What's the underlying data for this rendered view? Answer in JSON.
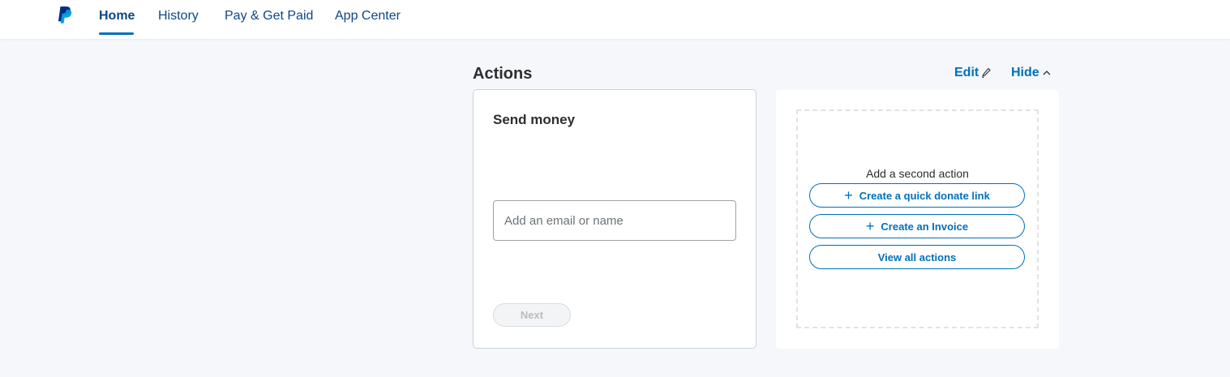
{
  "nav": {
    "items": [
      {
        "label": "Home",
        "active": true
      },
      {
        "label": "History"
      },
      {
        "label": "Pay & Get Paid"
      },
      {
        "label": "App Center"
      }
    ]
  },
  "actions": {
    "title": "Actions",
    "edit_label": "Edit",
    "hide_label": "Hide"
  },
  "send_money": {
    "title": "Send money",
    "input_placeholder": "Add an email or name",
    "input_value": "",
    "next_label": "Next"
  },
  "second_action": {
    "label": "Add a second action",
    "buttons": [
      {
        "label": "Create a quick donate link",
        "icon": "plus-icon"
      },
      {
        "label": "Create an Invoice",
        "icon": "plus-icon"
      },
      {
        "label": "View all actions"
      }
    ]
  },
  "colors": {
    "brand_blue": "#0070ba",
    "nav_text": "#0c4687",
    "page_bg": "#f5f7fa"
  }
}
